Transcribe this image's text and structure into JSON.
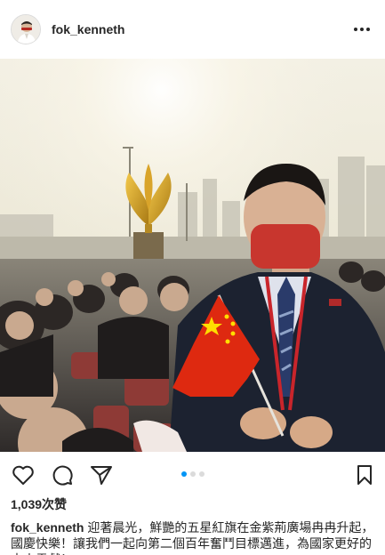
{
  "post": {
    "username": "fok_kenneth",
    "likes_text": "1,039次赞",
    "caption_user": "fok_kenneth",
    "caption_text": "迎著晨光，鮮艷的五星紅旗在金紫荊廣場冉冉升起，國慶快樂！讓我們一起向第二個百年奮鬥目標邁進，為國家更好的未來貢獻！",
    "carousel_total": 3,
    "carousel_active": 1
  },
  "icons": {
    "more": "more-horizontal-icon",
    "like": "heart-icon",
    "comment": "comment-icon",
    "share": "send-icon",
    "save": "bookmark-icon"
  },
  "colors": {
    "accent": "#0095f6",
    "text": "#262626",
    "flag_red": "#de2910",
    "flag_star": "#ffde00"
  }
}
